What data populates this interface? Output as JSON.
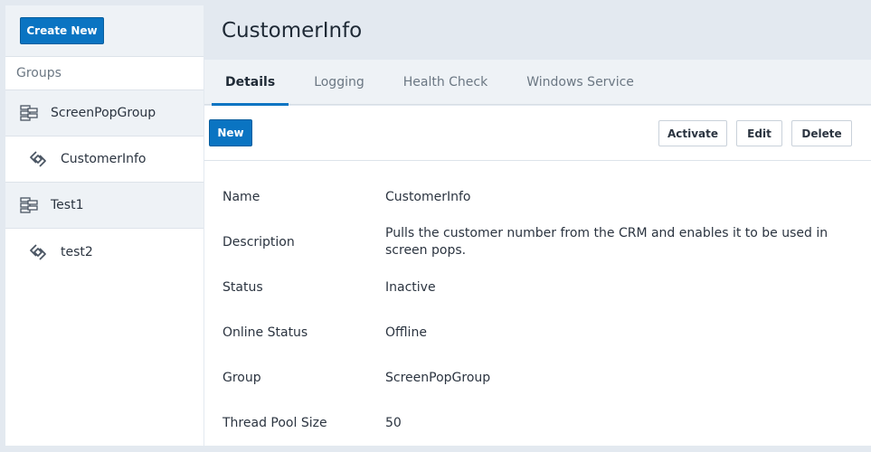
{
  "sidebar": {
    "create_label": "Create New",
    "groups_label": "Groups",
    "tree": [
      {
        "type": "group",
        "label": "ScreenPopGroup",
        "icon": "server-stack-icon"
      },
      {
        "type": "item",
        "label": "CustomerInfo",
        "icon": "integration-link-icon"
      },
      {
        "type": "group",
        "label": "Test1",
        "icon": "server-stack-icon"
      },
      {
        "type": "item",
        "label": "test2",
        "icon": "integration-link-icon"
      }
    ]
  },
  "main": {
    "title": "CustomerInfo",
    "tabs": [
      {
        "label": "Details",
        "active": true
      },
      {
        "label": "Logging",
        "active": false
      },
      {
        "label": "Health Check",
        "active": false
      },
      {
        "label": "Windows Service",
        "active": false
      }
    ],
    "toolbar": {
      "new_label": "New",
      "activate_label": "Activate",
      "edit_label": "Edit",
      "delete_label": "Delete"
    },
    "details": [
      {
        "label": "Name",
        "value": "CustomerInfo"
      },
      {
        "label": "Description",
        "value": "Pulls the customer number from the CRM and enables it to be used in screen pops."
      },
      {
        "label": "Status",
        "value": "Inactive"
      },
      {
        "label": "Online Status",
        "value": "Offline"
      },
      {
        "label": "Group",
        "value": "ScreenPopGroup"
      },
      {
        "label": "Thread Pool Size",
        "value": "50"
      }
    ]
  },
  "colors": {
    "accent": "#0a74c2",
    "background": "#e3e9f0",
    "panel": "#eef2f6"
  }
}
